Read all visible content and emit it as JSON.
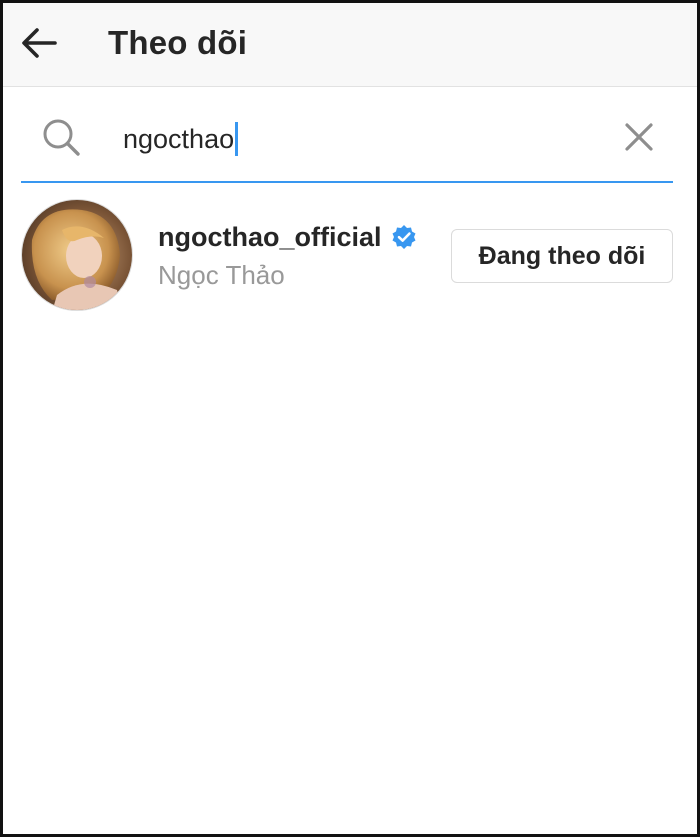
{
  "header": {
    "title": "Theo dõi",
    "back_icon": "arrow-left-icon"
  },
  "search": {
    "value": "ngocthao",
    "icon": "search-icon",
    "clear_icon": "close-icon",
    "accent_color": "#3897f0"
  },
  "results": [
    {
      "username": "ngocthao_official",
      "full_name": "Ngọc Thảo",
      "verified": true,
      "follow_label": "Đang theo dõi"
    }
  ],
  "colors": {
    "verified_badge": "#3897f0",
    "secondary_text": "#999999"
  }
}
